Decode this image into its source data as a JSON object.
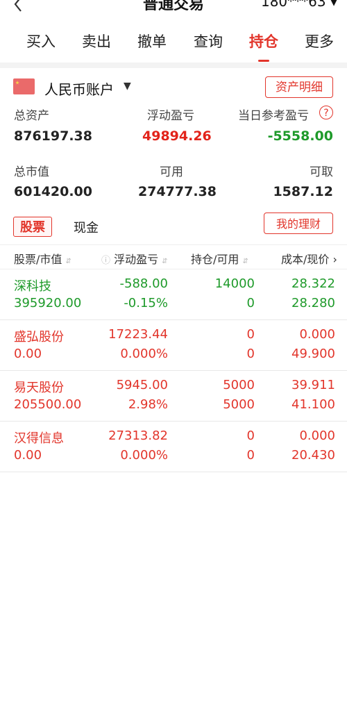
{
  "header": {
    "title": "普通交易",
    "account_masked": "180***63 ▾"
  },
  "tabs": [
    {
      "label": "买入"
    },
    {
      "label": "卖出"
    },
    {
      "label": "撤单"
    },
    {
      "label": "查询"
    },
    {
      "label": "持仓",
      "active": true
    },
    {
      "label": "更多"
    }
  ],
  "account": {
    "currency_name": "人民币账户",
    "detail_button": "资产明细"
  },
  "summary": {
    "total_assets_label": "总资产",
    "total_assets": "876197.38",
    "float_pl_label": "浮动盈亏",
    "float_pl": "49894.26",
    "today_pl_label": "当日参考盈亏",
    "today_pl": "-5558.00",
    "market_value_label": "总市值",
    "market_value": "601420.00",
    "available_label": "可用",
    "available": "274777.38",
    "withdrawable_label": "可取",
    "withdrawable": "1587.12"
  },
  "subtabs": {
    "stock": "股票",
    "cash": "现金",
    "finance_button": "我的理财"
  },
  "table": {
    "headers": [
      "股票/市值",
      "浮动盈亏",
      "持仓/可用",
      "成本/现价"
    ],
    "rows": [
      {
        "name": "深科技",
        "mv": "395920.00",
        "pl": "-588.00",
        "pl_pct": "-0.15%",
        "pos": "14000",
        "avail": "0",
        "cost": "28.322",
        "price": "28.280",
        "color": "#1e9a2a"
      },
      {
        "name": "盛弘股份",
        "mv": "0.00",
        "pl": "17223.44",
        "pl_pct": "0.000%",
        "pos": "0",
        "avail": "0",
        "cost": "0.000",
        "price": "49.900",
        "color": "#e2352b"
      },
      {
        "name": "易天股份",
        "mv": "205500.00",
        "pl": "5945.00",
        "pl_pct": "2.98%",
        "pos": "5000",
        "avail": "5000",
        "cost": "39.911",
        "price": "41.100",
        "color": "#e2352b"
      },
      {
        "name": "汉得信息",
        "mv": "0.00",
        "pl": "27313.82",
        "pl_pct": "0.000%",
        "pos": "0",
        "avail": "0",
        "cost": "0.000",
        "price": "20.430",
        "color": "#e2352b"
      }
    ]
  }
}
